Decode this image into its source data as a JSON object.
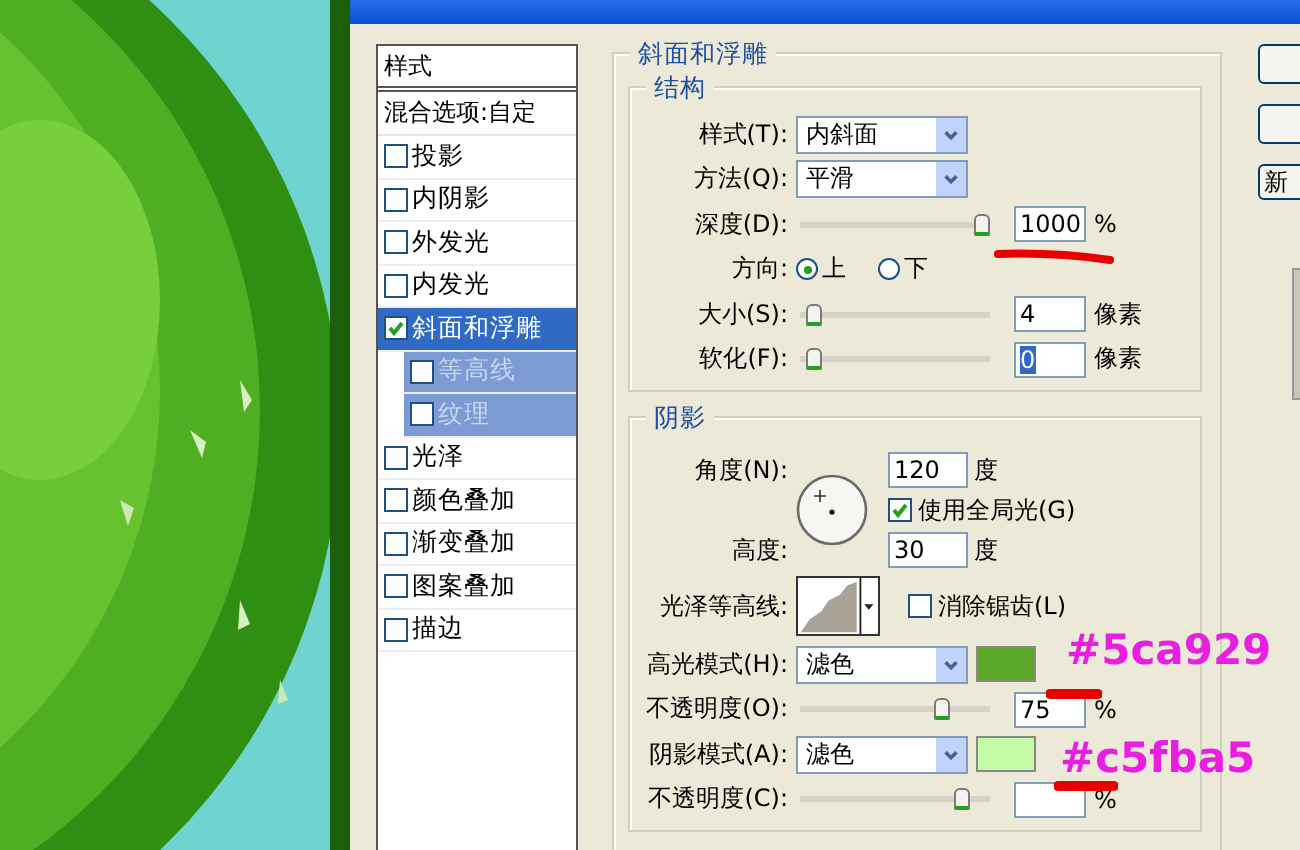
{
  "styles_panel": {
    "header": "样式",
    "blend_options": "混合选项:自定",
    "items": [
      {
        "label": "投影",
        "checked": false,
        "selected": false
      },
      {
        "label": "内阴影",
        "checked": false,
        "selected": false
      },
      {
        "label": "外发光",
        "checked": false,
        "selected": false
      },
      {
        "label": "内发光",
        "checked": false,
        "selected": false
      },
      {
        "label": "斜面和浮雕",
        "checked": true,
        "selected": true,
        "children": [
          {
            "label": "等高线",
            "checked": false,
            "selected": false
          },
          {
            "label": "纹理",
            "checked": false,
            "selected": false
          }
        ]
      },
      {
        "label": "光泽",
        "checked": false,
        "selected": false
      },
      {
        "label": "颜色叠加",
        "checked": false,
        "selected": false
      },
      {
        "label": "渐变叠加",
        "checked": false,
        "selected": false
      },
      {
        "label": "图案叠加",
        "checked": false,
        "selected": false
      },
      {
        "label": "描边",
        "checked": false,
        "selected": false
      }
    ]
  },
  "bevel": {
    "title": "斜面和浮雕",
    "structure": {
      "title": "结构",
      "rows": [
        {
          "kind": "select",
          "label": "样式(T):",
          "value": "内斜面"
        },
        {
          "kind": "select",
          "label": "方法(Q):",
          "value": "平滑"
        },
        {
          "kind": "slider",
          "label": "深度(D):",
          "level": 1,
          "value": "1000",
          "unit": "%"
        },
        {
          "kind": "radio",
          "label": "方向:",
          "options": [
            {
              "label": "上",
              "selected": true
            },
            {
              "label": "下",
              "selected": false
            }
          ]
        },
        {
          "kind": "slider",
          "label": "大小(S):",
          "level": 0.04,
          "value": "4",
          "unit": "像素"
        },
        {
          "kind": "slider",
          "label": "软化(F):",
          "level": 0.04,
          "value": "0",
          "unit": "像素",
          "value_highlighted": true
        }
      ]
    },
    "shading": {
      "title": "阴影",
      "angle_label": "角度(N):",
      "angle": "120",
      "angle_unit": "度",
      "global_light": {
        "label": "使用全局光(G)",
        "checked": true
      },
      "altitude_label": "高度:",
      "altitude": "30",
      "altitude_unit": "度",
      "gloss_label": "光泽等高线:",
      "anti_alias": {
        "label": "消除锯齿(L)",
        "checked": false
      },
      "rows": [
        {
          "kind": "mode",
          "label": "高光模式(H):",
          "value": "滤色",
          "color": "#5ca929"
        },
        {
          "kind": "slider",
          "label": "不透明度(O):",
          "level": 0.77,
          "value": "75",
          "unit": "%"
        },
        {
          "kind": "mode",
          "label": "阴影模式(A):",
          "value": "滤色",
          "color": "#c5fba5"
        },
        {
          "kind": "slider",
          "label": "不透明度(C):",
          "level": 0.88,
          "unit": "%"
        }
      ]
    }
  },
  "side_buttons": [
    "新"
  ],
  "annotations": [
    {
      "text": "#5ca929"
    },
    {
      "text": "#c5fba5"
    }
  ]
}
